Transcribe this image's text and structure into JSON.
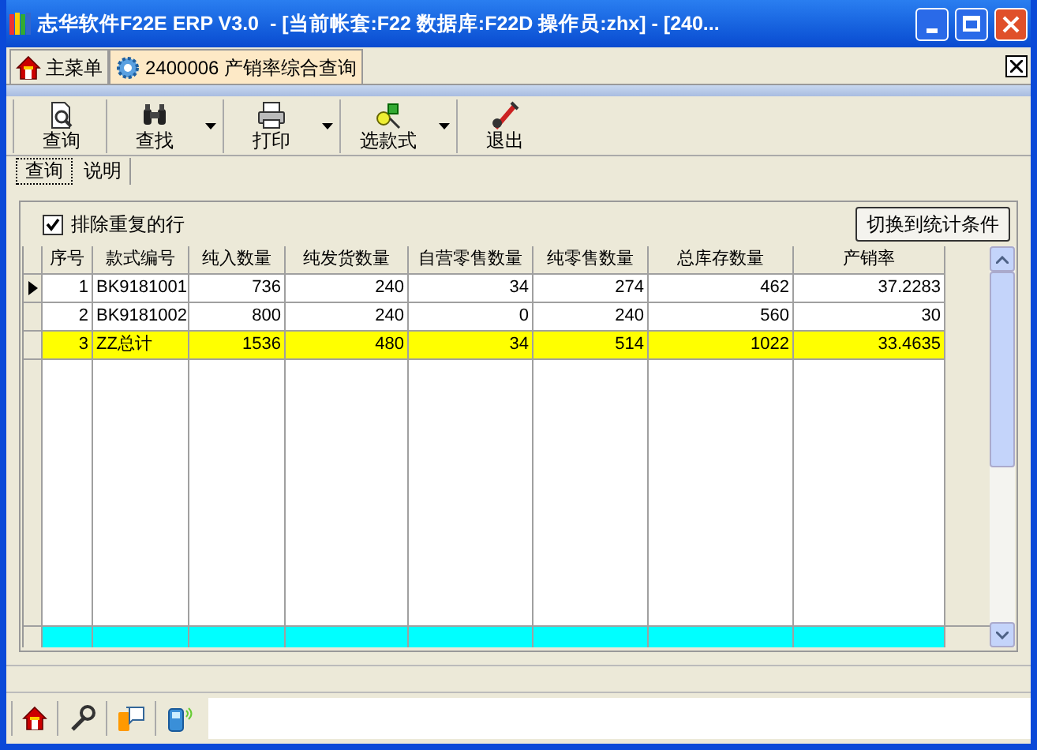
{
  "window": {
    "title": "志华软件F22E ERP V3.0  - [当前帐套:F22 数据库:F22D 操作员:zhx] - [240..."
  },
  "doc_tabs": [
    {
      "label": "主菜单",
      "selected": false
    },
    {
      "label": "2400006 产销率综合查询",
      "selected": true
    }
  ],
  "toolbar": [
    {
      "label": "查询",
      "dropdown": false
    },
    {
      "label": "查找",
      "dropdown": true
    },
    {
      "label": "打印",
      "dropdown": true
    },
    {
      "label": "选款式",
      "dropdown": true
    },
    {
      "label": "退出",
      "dropdown": false
    }
  ],
  "sub_tabs": [
    {
      "label": "查询",
      "selected": true
    },
    {
      "label": "说明",
      "selected": false
    }
  ],
  "exclude_duplicates": {
    "label": "排除重复的行",
    "checked": true
  },
  "switch_button": "切换到统计条件",
  "table": {
    "columns": [
      "序号",
      "款式编号",
      "纯入数量",
      "纯发货数量",
      "自营零售数量",
      "纯零售数量",
      "总库存数量",
      "产销率"
    ],
    "rows": [
      {
        "cells": [
          "1",
          "BK9181001",
          "736",
          "240",
          "34",
          "274",
          "462",
          "37.2283"
        ],
        "current": true,
        "highlighted": false
      },
      {
        "cells": [
          "2",
          "BK9181002",
          "800",
          "240",
          "0",
          "240",
          "560",
          "30"
        ],
        "current": false,
        "highlighted": false
      },
      {
        "cells": [
          "3",
          "ZZ总计",
          "1536",
          "480",
          "34",
          "514",
          "1022",
          "33.4635"
        ],
        "current": false,
        "highlighted": true
      }
    ]
  }
}
